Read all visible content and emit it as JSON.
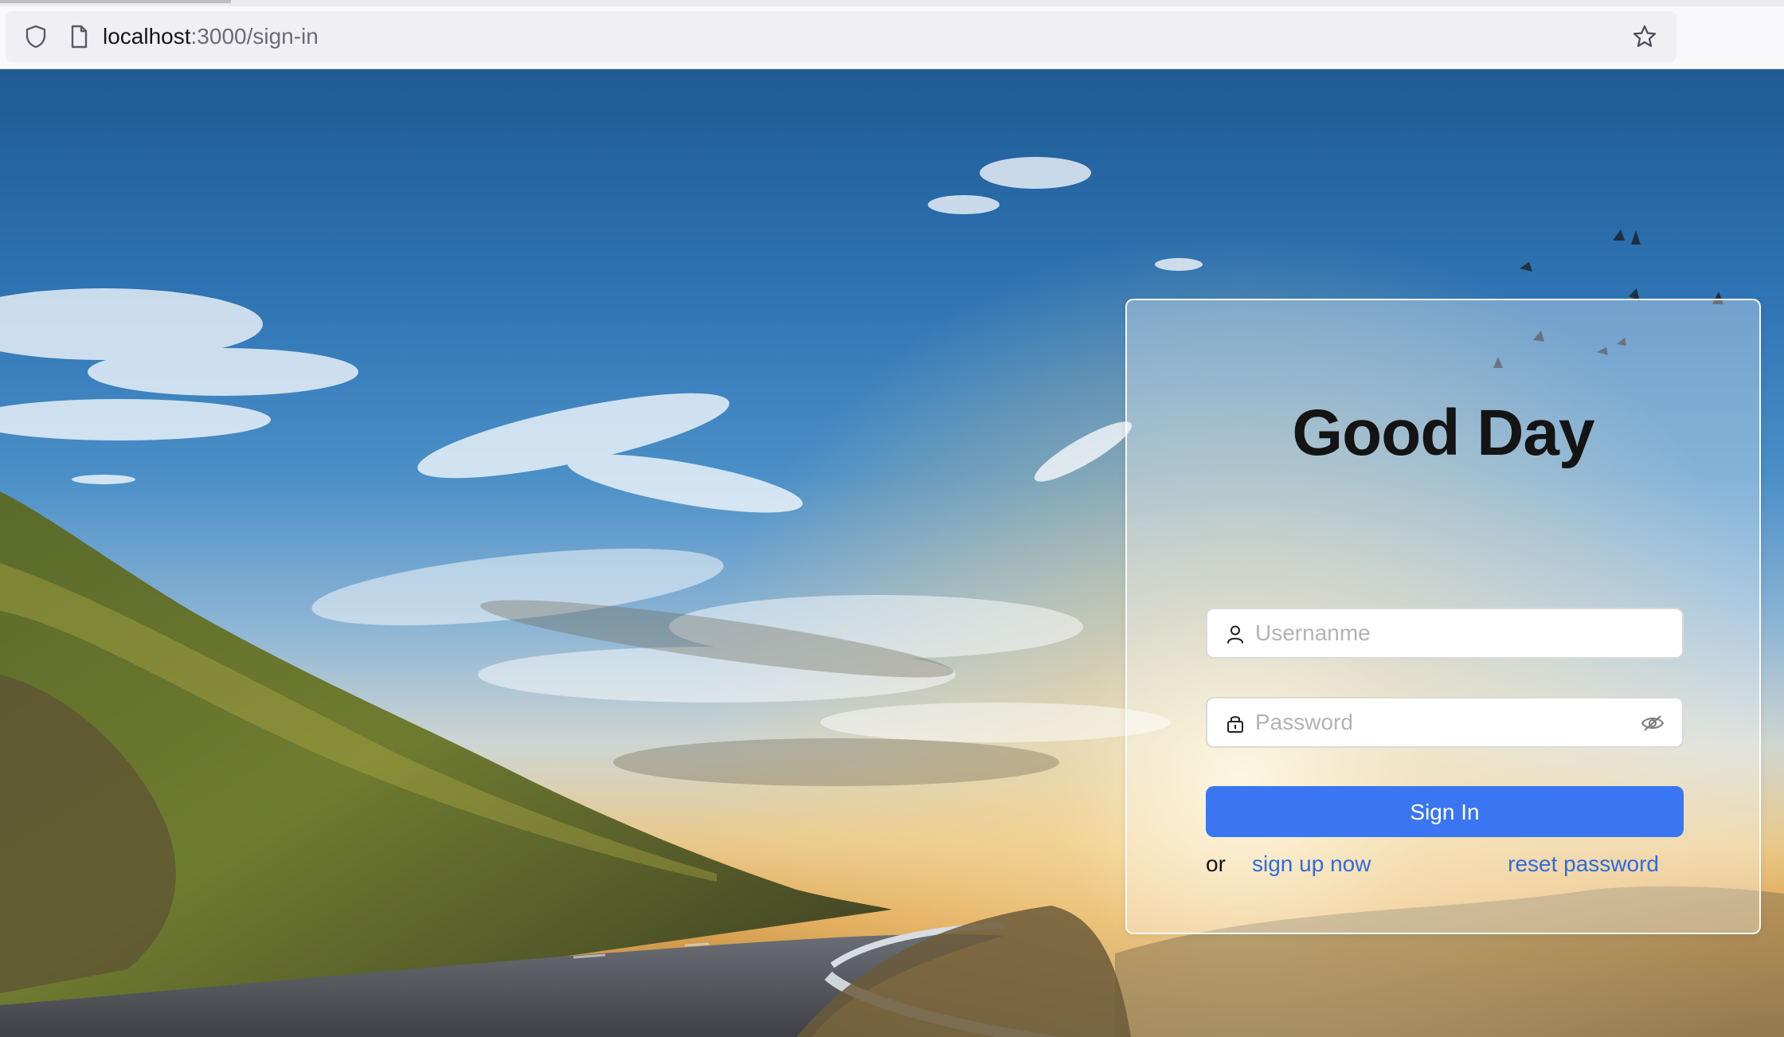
{
  "browser": {
    "url_host": "localhost",
    "url_path": ":3000/sign-in",
    "icons": {
      "security": "shield-icon",
      "page": "page-icon",
      "bookmark": "star-icon"
    }
  },
  "signin": {
    "title": "Good Day",
    "username_placeholder": "Usernanme",
    "password_placeholder": "Password",
    "button_label": "Sign In",
    "or_text": "or",
    "signup_link": "sign up now",
    "reset_link": "reset password",
    "accent_color": "#3a76f2",
    "link_color": "#2f6bde"
  },
  "background": {
    "description_icon": "landscape-photo"
  }
}
